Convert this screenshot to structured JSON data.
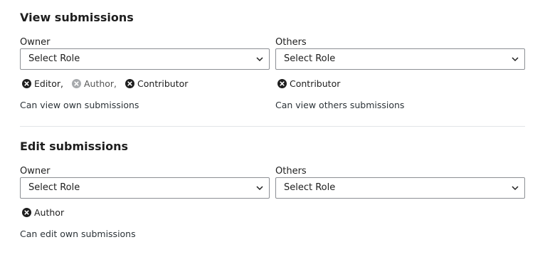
{
  "view": {
    "title": "View submissions",
    "owner": {
      "label": "Owner",
      "select_value": "Select Role",
      "tokens": [
        {
          "label": "Editor,",
          "icon": "remove-circle-icon",
          "disabled": false
        },
        {
          "label": "Author,",
          "icon": "remove-circle-icon",
          "disabled": true
        },
        {
          "label": "Contributor",
          "icon": "remove-circle-icon",
          "disabled": false
        }
      ],
      "description": "Can view own submissions"
    },
    "others": {
      "label": "Others",
      "select_value": "Select Role",
      "tokens": [
        {
          "label": "Contributor",
          "icon": "remove-circle-icon",
          "disabled": false
        }
      ],
      "description": "Can view others submissions"
    }
  },
  "edit": {
    "title": "Edit submissions",
    "owner": {
      "label": "Owner",
      "select_value": "Select Role",
      "tokens": [
        {
          "label": "Author",
          "icon": "remove-circle-icon",
          "disabled": false
        }
      ],
      "description": "Can edit own submissions"
    },
    "others": {
      "label": "Others",
      "select_value": "Select Role",
      "tokens": [],
      "description": ""
    }
  },
  "colors": {
    "text": "#1e1e1e",
    "border": "#8c8f94",
    "divider": "#e2e4e7",
    "icon_active": "#1e1e1e",
    "icon_disabled": "#a7aaad"
  }
}
